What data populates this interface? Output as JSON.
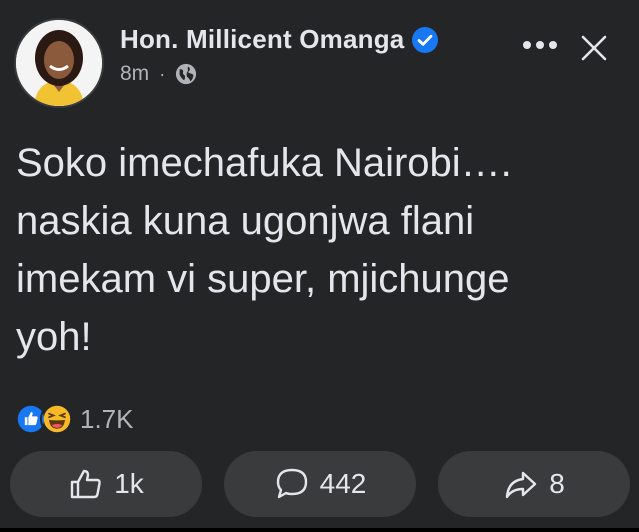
{
  "post": {
    "author": "Hon. Millicent Omanga",
    "time": "8m",
    "separator": "·",
    "text": "Soko imechafuka Nairobi….\nnaskia kuna ugonjwa flani\nimekam vi super, mjichunge\nyoh!"
  },
  "icons": {
    "verified": "verified-badge-icon",
    "audience": "globe-icon",
    "more": "more-options-icon",
    "close": "close-icon",
    "like": "thumbs-up-icon",
    "comment": "comment-icon",
    "share": "share-icon"
  },
  "reactions": {
    "count": "1.7K",
    "types": [
      "like",
      "haha"
    ]
  },
  "actions": {
    "like_count": "1k",
    "comment_count": "442",
    "share_count": "8"
  },
  "colors": {
    "background": "#242526",
    "button": "#3a3b3c",
    "verified": "#1877f2",
    "haha": "#f7b928"
  }
}
